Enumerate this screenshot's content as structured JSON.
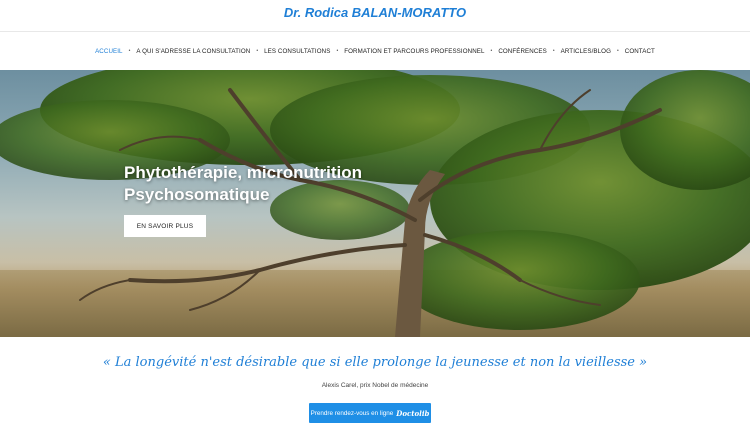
{
  "header": {
    "site_title": "Dr. Rodica BALAN-MORATTO"
  },
  "nav": {
    "items": [
      {
        "label": "ACCUEIL",
        "active": true
      },
      {
        "label": "A QUI S'ADRESSE LA CONSULTATION"
      },
      {
        "label": "LES CONSULTATIONS"
      },
      {
        "label": "FORMATION ET PARCOURS PROFESSIONNEL"
      },
      {
        "label": "CONFÉRENCES"
      },
      {
        "label": "ARTICLES/BLOG"
      },
      {
        "label": "CONTACT"
      }
    ],
    "separator": "•"
  },
  "hero": {
    "heading_line1": "Phytothérapie, micronutrition",
    "heading_line2": "Psychosomatique",
    "button_label": "EN SAVOIR PLUS"
  },
  "quote": {
    "text": "« La longévité n'est désirable que si elle prolonge la jeunesse et non la vieillesse »",
    "author": "Alexis Carel, prix Nobel de médecine"
  },
  "appointment": {
    "button_label": "Prendre rendez-vous en ligne",
    "logo_text": "Doctolib"
  },
  "colors": {
    "accent": "#1f7fd6",
    "button_blue": "#1f8fe6"
  }
}
